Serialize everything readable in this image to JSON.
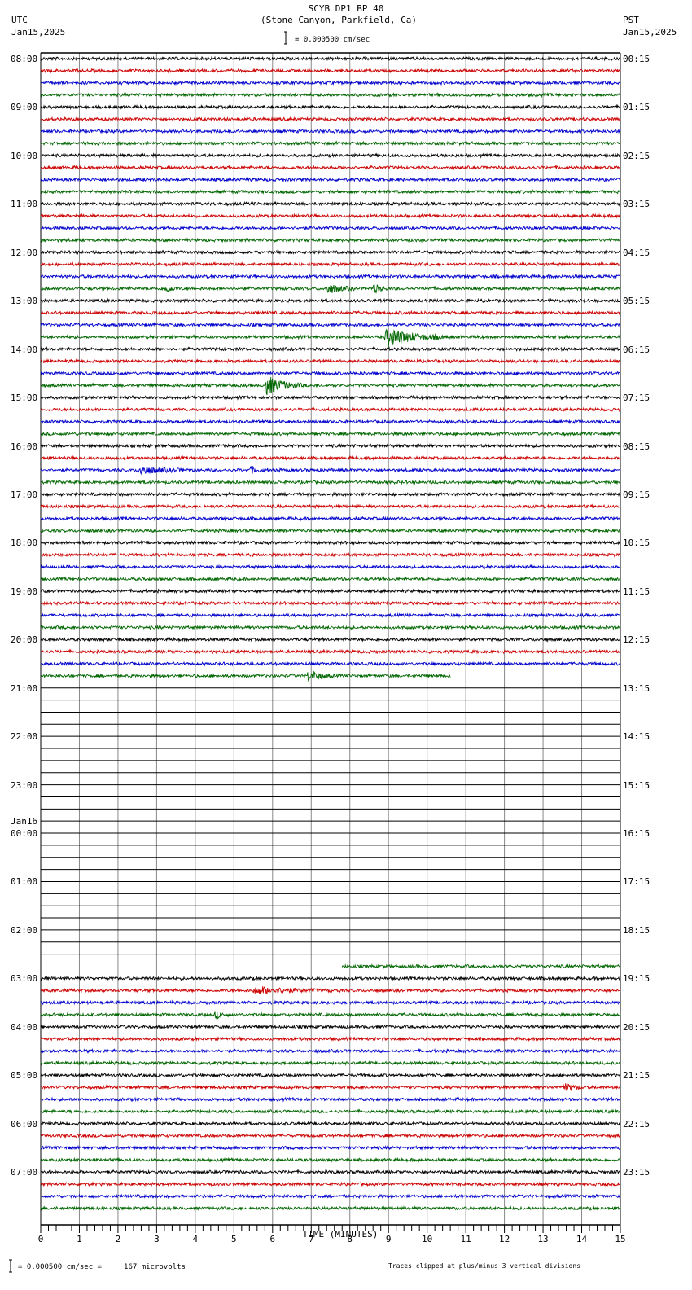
{
  "header": {
    "title": "SCYB DP1 BP 40",
    "subtitle": "(Stone Canyon, Parkfield, Ca)",
    "left_tz": "UTC",
    "left_date": "Jan15,2025",
    "right_tz": "PST",
    "right_date": "Jan15,2025",
    "scale_text": "= 0.000500 cm/sec"
  },
  "footer": {
    "scale_text": "= 0.000500 cm/sec =     167 microvolts",
    "clip_note": "Traces clipped at plus/minus 3 vertical divisions"
  },
  "chart_data": {
    "type": "seismogram",
    "xlabel": "TIME (MINUTES)",
    "xlim": [
      0,
      15
    ],
    "x_ticks": [
      "0",
      "1",
      "2",
      "3",
      "4",
      "5",
      "6",
      "7",
      "8",
      "9",
      "10",
      "11",
      "12",
      "13",
      "14",
      "15"
    ],
    "rows_total": 96,
    "minutes_per_row": 15,
    "trace_colors": [
      "#000000",
      "#cc0000",
      "#0000cc",
      "#006600"
    ],
    "left_labels": [
      "08:00",
      "09:00",
      "10:00",
      "11:00",
      "12:00",
      "13:00",
      "14:00",
      "15:00",
      "16:00",
      "17:00",
      "18:00",
      "19:00",
      "20:00",
      "21:00",
      "22:00",
      "23:00",
      "00:00",
      "01:00",
      "02:00",
      "03:00",
      "04:00",
      "05:00",
      "06:00",
      "07:00"
    ],
    "date_change_label": "Jan16",
    "right_labels": [
      "00:15",
      "01:15",
      "02:15",
      "03:15",
      "04:15",
      "05:15",
      "06:15",
      "07:15",
      "08:15",
      "09:15",
      "10:15",
      "11:15",
      "12:15",
      "13:15",
      "14:15",
      "15:15",
      "16:15",
      "17:15",
      "18:15",
      "19:15",
      "20:15",
      "21:15",
      "22:15",
      "23:15"
    ],
    "no_data_rows": [
      52,
      74
    ],
    "partial_rows": [
      {
        "row": 51,
        "start_min": 0,
        "end_min": 10.6
      },
      {
        "row": 75,
        "start_min": 7.8,
        "end_min": 15
      }
    ],
    "events": [
      {
        "row": 19,
        "start_min": 3.2,
        "end_min": 3.6,
        "amp": 1.2
      },
      {
        "row": 19,
        "start_min": 7.4,
        "end_min": 8.2,
        "amp": 1.6
      },
      {
        "row": 19,
        "start_min": 8.6,
        "end_min": 9.0,
        "amp": 1.5
      },
      {
        "row": 23,
        "start_min": 8.9,
        "end_min": 10.6,
        "amp": 3
      },
      {
        "row": 27,
        "start_min": 5.8,
        "end_min": 6.9,
        "amp": 3
      },
      {
        "row": 34,
        "start_min": 2.5,
        "end_min": 4.0,
        "amp": 1.2
      },
      {
        "row": 34,
        "start_min": 5.4,
        "end_min": 5.9,
        "amp": 1.1
      },
      {
        "row": 51,
        "start_min": 6.9,
        "end_min": 7.6,
        "amp": 2
      },
      {
        "row": 77,
        "start_min": 5.5,
        "end_min": 7.8,
        "amp": 1.1
      },
      {
        "row": 79,
        "start_min": 4.5,
        "end_min": 4.9,
        "amp": 1.2
      },
      {
        "row": 85,
        "start_min": 13.5,
        "end_min": 14.1,
        "amp": 1.3
      }
    ]
  }
}
